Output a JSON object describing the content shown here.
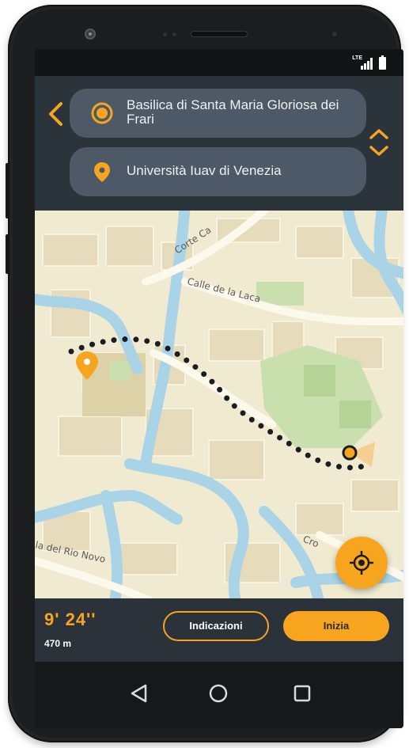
{
  "status_bar": {
    "network": "LTE"
  },
  "route": {
    "origin": "Basilica di Santa Maria Gloriosa dei Frari",
    "destination": "Università Iuav di Venezia",
    "origin_icon": "current-location-icon",
    "destination_icon": "map-pin-icon"
  },
  "map": {
    "labels": {
      "street_1": "Corte Ca",
      "street_2": "Calle de la Laca",
      "street_3": "la del Rio Novo",
      "street_4": "Cro"
    },
    "recenter_icon": "crosshair-icon"
  },
  "trip": {
    "duration": "9' 24''",
    "distance": "470 m"
  },
  "actions": {
    "directions_label": "Indicazioni",
    "start_label": "Inizia"
  },
  "colors": {
    "accent": "#f7a51f",
    "panel": "#2b323a",
    "field": "#4d5966",
    "map_land": "#f0ead0",
    "map_water": "#a9d3e6",
    "map_park": "#c9dfae"
  }
}
